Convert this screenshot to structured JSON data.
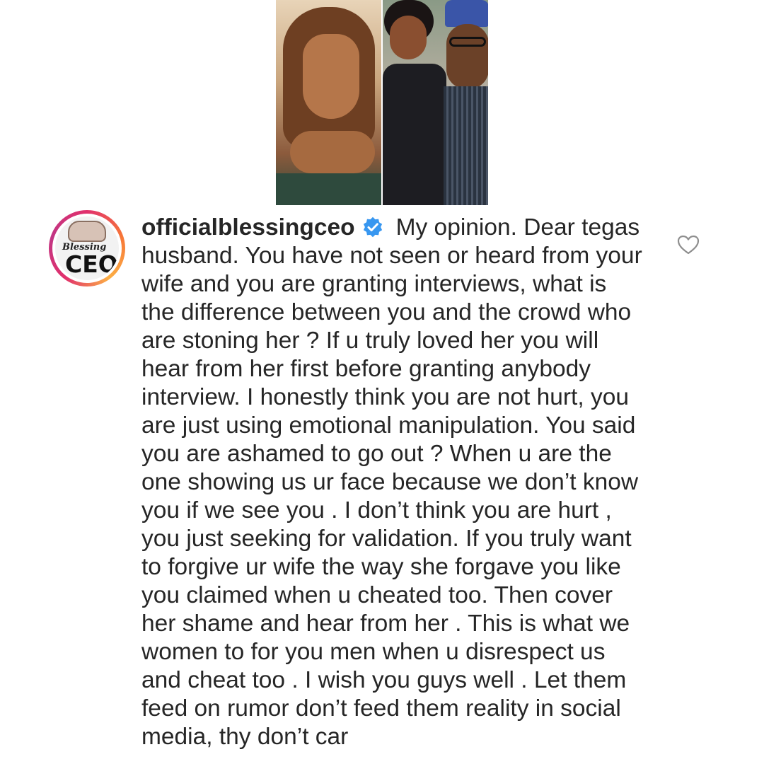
{
  "post": {
    "photos": [
      "photo-left",
      "photo-right"
    ]
  },
  "comment": {
    "avatar": {
      "script_text": "Blessing",
      "logo_text": "CEO"
    },
    "username": "officialblessingceo",
    "verified_icon": "verified-badge-icon",
    "like_icon": "heart-outline-icon",
    "lines": [
      "My opinion. Dear tegas",
      "husband. You have not seen or heard from your",
      "wife and you are granting  interviews, what is",
      "the difference between you and the crowd who",
      "are stoning her ? If u truly loved her you will",
      "hear from her first before granting anybody",
      "interview. I honestly think you are not hurt, you",
      "are just using emotional manipulation. You said",
      "you are ashamed to go out ? When u are the",
      "one showing us ur face because we don’t know",
      "you if we see you . I don’t think you are hurt ,",
      "you just seeking for validation. If you truly want",
      "to forgive ur wife the way she forgave you like",
      "you claimed when u cheated too. Then cover",
      "her shame and hear from her . This is what we",
      "women to for you men when u disrespect us",
      "and cheat too . I wish you guys well .  Let them",
      "feed on rumor don’t feed them reality in social",
      "media, thy don’t car"
    ]
  },
  "colors": {
    "text": "#262626",
    "verified": "#3897f0",
    "story_ring": "#e1306c"
  }
}
